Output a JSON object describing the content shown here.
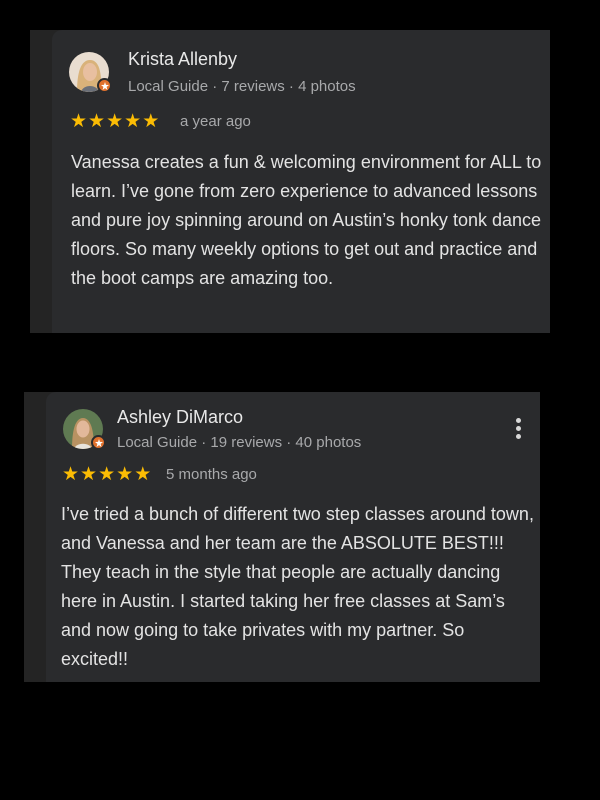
{
  "reviews": [
    {
      "name": "Krista Allenby",
      "meta": "Local Guide · 7 reviews · 4 photos",
      "rating": 5,
      "stars": "★★★★★",
      "date": "a year ago",
      "text": "Vanessa creates a fun & welcoming environment for ALL to learn. I’ve gone from zero experience to advanced lessons and pure joy spinning around on Austin’s honky tonk dance floors. So many weekly options to get out and practice and the boot camps are amazing too."
    },
    {
      "name": "Ashley DiMarco",
      "meta": "Local Guide · 19 reviews · 40 photos",
      "rating": 5,
      "stars": "★★★★★",
      "date": "5 months ago",
      "text": "I’ve tried a bunch of different two step classes around town, and Vanessa and her team are the ABSOLUTE BEST!!! They teach in the style that people are actually dancing here in Austin. I started taking her free classes at Sam’s and now going to take privates with my partner. So excited!!"
    }
  ],
  "colors": {
    "star": "#fbbc04",
    "local_guide_badge": "#e0712d",
    "card_bg": "#2a2b2d"
  },
  "icons": [
    "avatar",
    "local-guide-badge-icon",
    "star-icon",
    "more-vert-icon"
  ]
}
